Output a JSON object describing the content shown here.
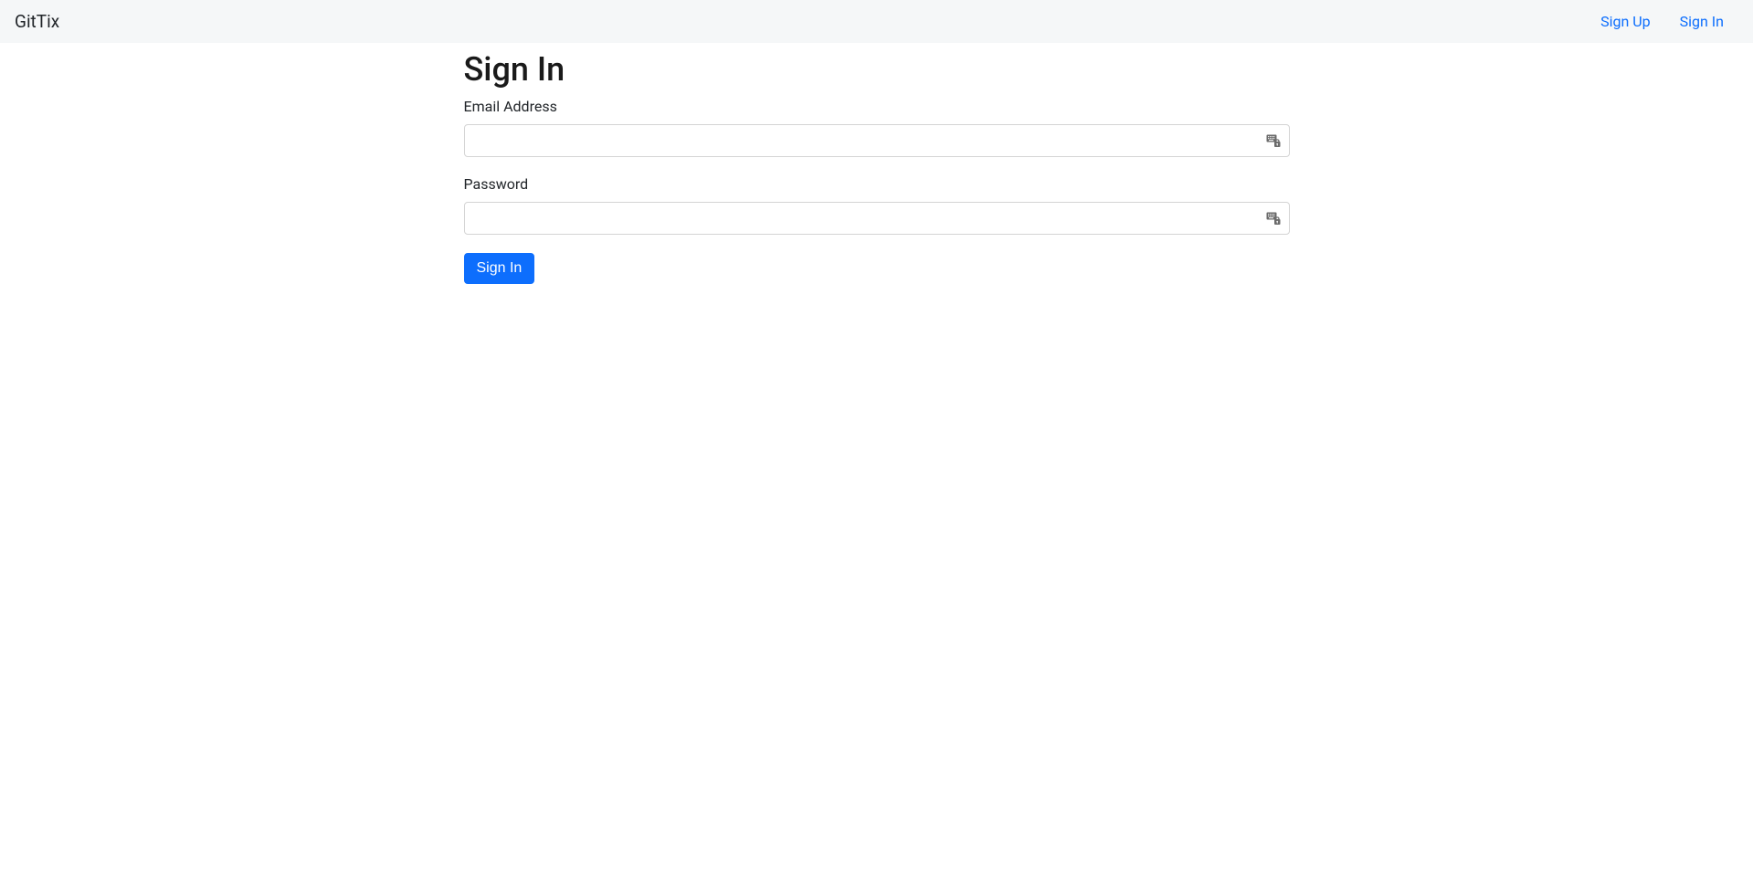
{
  "navbar": {
    "brand": "GitTix",
    "links": [
      {
        "label": "Sign Up"
      },
      {
        "label": "Sign In"
      }
    ]
  },
  "page": {
    "title": "Sign In"
  },
  "form": {
    "email_label": "Email Address",
    "email_value": "",
    "password_label": "Password",
    "password_value": "",
    "submit_label": "Sign In"
  }
}
